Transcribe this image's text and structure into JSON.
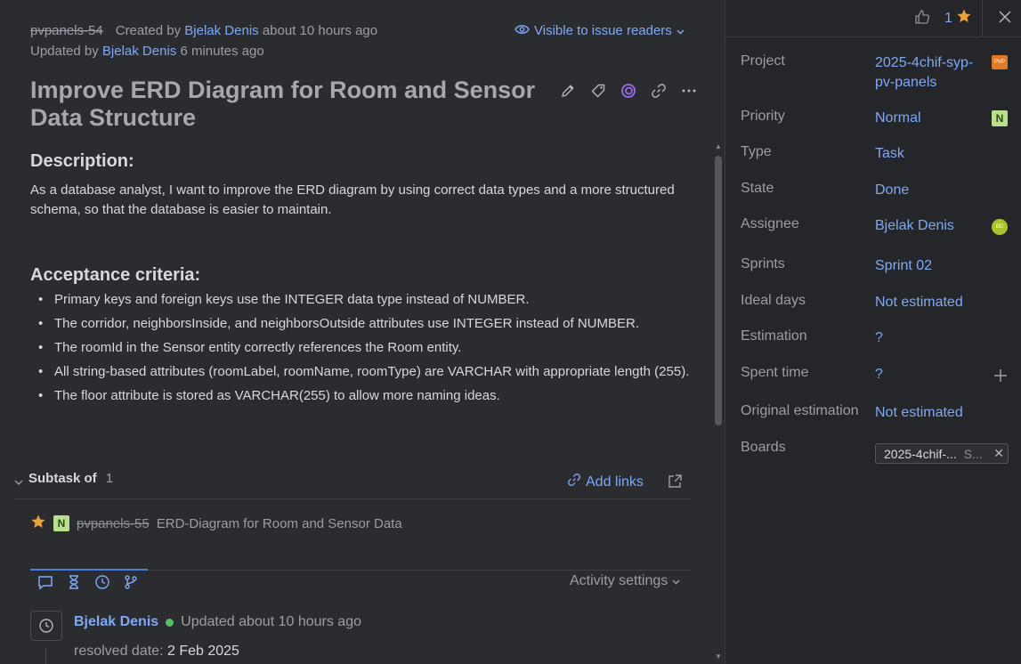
{
  "issue": {
    "id": "pvpanels-54",
    "created_prefix": "Created by",
    "creator": "Bjelak Denis",
    "created_time": "about 10 hours ago",
    "updated_prefix": "Updated by",
    "updater": "Bjelak Denis",
    "updated_time": "6 minutes ago",
    "visibility": "Visible to issue readers",
    "title": "Improve ERD Diagram for Room and Sensor Data Structure"
  },
  "description": {
    "heading": "Description:",
    "text": "As a database analyst, I want to improve the ERD diagram by using correct data types and a more structured schema, so that the database is easier to maintain."
  },
  "acceptance": {
    "heading": "Acceptance criteria:",
    "items": [
      "Primary keys and foreign keys use the INTEGER data type instead of NUMBER.",
      "The corridor, neighborsInside, and neighborsOutside attributes use INTEGER instead of NUMBER.",
      "The roomId in the Sensor entity correctly references the Room entity.",
      "All string-based attributes (roomLabel, roomName, roomType) are VARCHAR with appropriate length (255).",
      "The floor attribute is stored as VARCHAR(255) to allow more naming ideas."
    ]
  },
  "subtask": {
    "label": "Subtask of",
    "count": "1",
    "add_links": "Add links",
    "item_badge": "N",
    "item_id": "pvpanels-55",
    "item_title": "ERD-Diagram for Room and Sensor Data"
  },
  "activity": {
    "settings_label": "Activity settings",
    "user": "Bjelak Denis",
    "update_text": "Updated about 10 hours ago",
    "field_label": "resolved date:",
    "field_value": "2 Feb 2025"
  },
  "sidebar": {
    "votes": "1",
    "project_label": "Project",
    "project_value": "2025-4chif-syp-pv-panels",
    "project_badge": "PVP",
    "priority_label": "Priority",
    "priority_value": "Normal",
    "priority_badge": "N",
    "type_label": "Type",
    "type_value": "Task",
    "state_label": "State",
    "state_value": "Done",
    "assignee_label": "Assignee",
    "assignee_value": "Bjelak Denis",
    "assignee_initials": "BD",
    "sprints_label": "Sprints",
    "sprints_value": "Sprint 02",
    "ideal_label": "Ideal days",
    "ideal_value": "Not estimated",
    "estimation_label": "Estimation",
    "estimation_value": "?",
    "spent_label": "Spent time",
    "spent_value": "?",
    "original_label": "Original estimation",
    "original_value": "Not estimated",
    "boards_label": "Boards",
    "board_name": "2025-4chif-...",
    "board_sprint": "S..."
  },
  "colors": {
    "accent": "#7fa9f4",
    "background": "#2b2c30",
    "sidebar_bg": "#252629",
    "star": "#e8a33d",
    "online": "#5dbb63"
  }
}
